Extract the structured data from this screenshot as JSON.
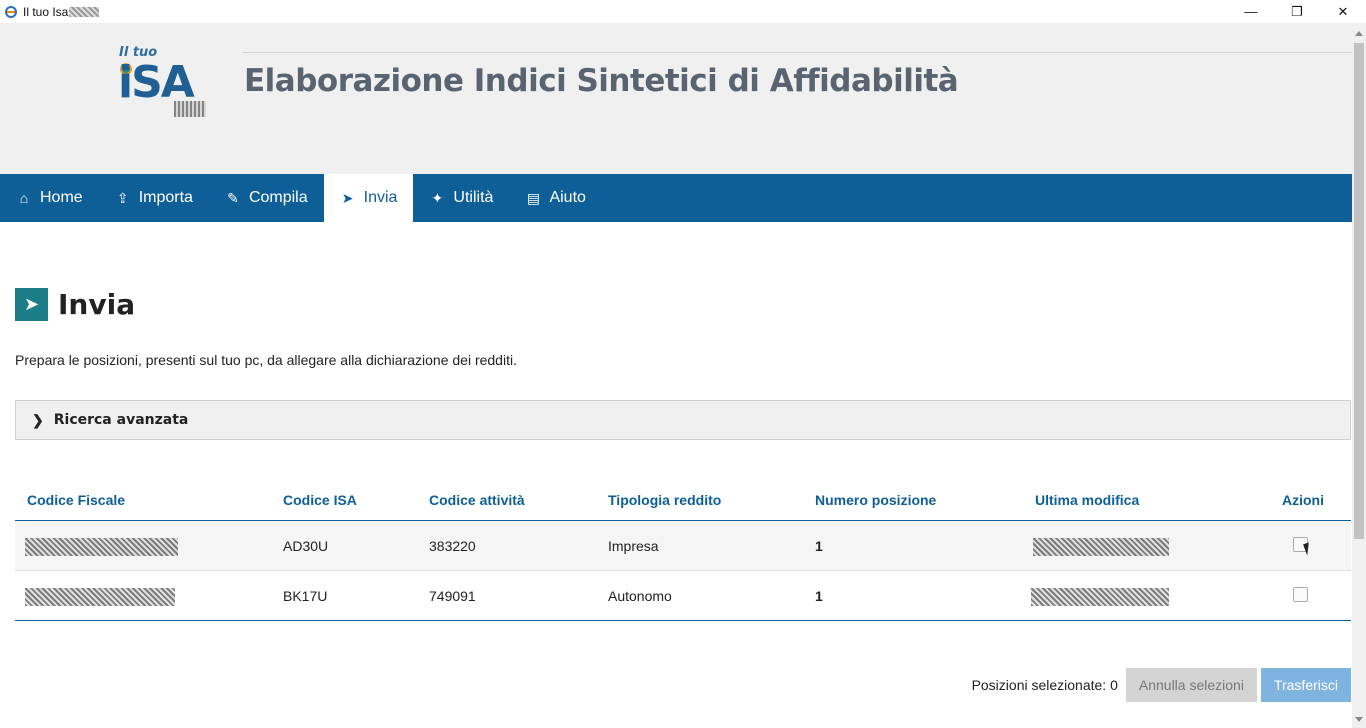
{
  "window": {
    "title": "Il tuo Isa",
    "controls": {
      "minimize": "—",
      "maximize": "❐",
      "close": "✕"
    }
  },
  "header": {
    "logo_small": "Il tuo",
    "logo_big": "iSA",
    "app_title": "Elaborazione Indici Sintetici di Affidabilità"
  },
  "nav": {
    "items": [
      {
        "label": "Home",
        "icon": "home-icon",
        "glyph": "⌂"
      },
      {
        "label": "Importa",
        "icon": "upload-icon",
        "glyph": "⇪"
      },
      {
        "label": "Compila",
        "icon": "pencil-icon",
        "glyph": "✎"
      },
      {
        "label": "Invia",
        "icon": "send-icon",
        "glyph": "➤"
      },
      {
        "label": "Utilità",
        "icon": "wrench-icon",
        "glyph": "✦"
      },
      {
        "label": "Aiuto",
        "icon": "book-icon",
        "glyph": "▤"
      }
    ],
    "active": "Invia"
  },
  "page": {
    "title": "Invia",
    "title_icon_glyph": "➤",
    "description": "Prepara le posizioni, presenti sul tuo pc, da allegare alla dichiarazione dei redditi."
  },
  "ricerca": {
    "label": "Ricerca avanzata",
    "chevron": "❯"
  },
  "table": {
    "headers": {
      "codice_fiscale": "Codice Fiscale",
      "codice_isa": "Codice ISA",
      "codice_attivita": "Codice attività",
      "tipologia": "Tipologia reddito",
      "numero_posizione": "Numero posizione",
      "ultima_modifica": "Ultima modifica",
      "azioni": "Azioni"
    },
    "rows": [
      {
        "codice_isa": "AD30U",
        "codice_attivita": "383220",
        "tipologia": "Impresa",
        "numero_posizione": "1",
        "selected": false
      },
      {
        "codice_isa": "BK17U",
        "codice_attivita": "749091",
        "tipologia": "Autonomo",
        "numero_posizione": "1",
        "selected": false
      }
    ]
  },
  "footer": {
    "selected_label": "Posizioni selezionate: 0",
    "annulla_label": "Annulla selezioni",
    "trasferisci_label": "Trasferisci"
  },
  "colors": {
    "nav_bg": "#0e5f98",
    "header_bg": "#f0f0f0",
    "accent_teal": "#1b7d88",
    "trasferisci_bg": "#7fb3e0"
  }
}
